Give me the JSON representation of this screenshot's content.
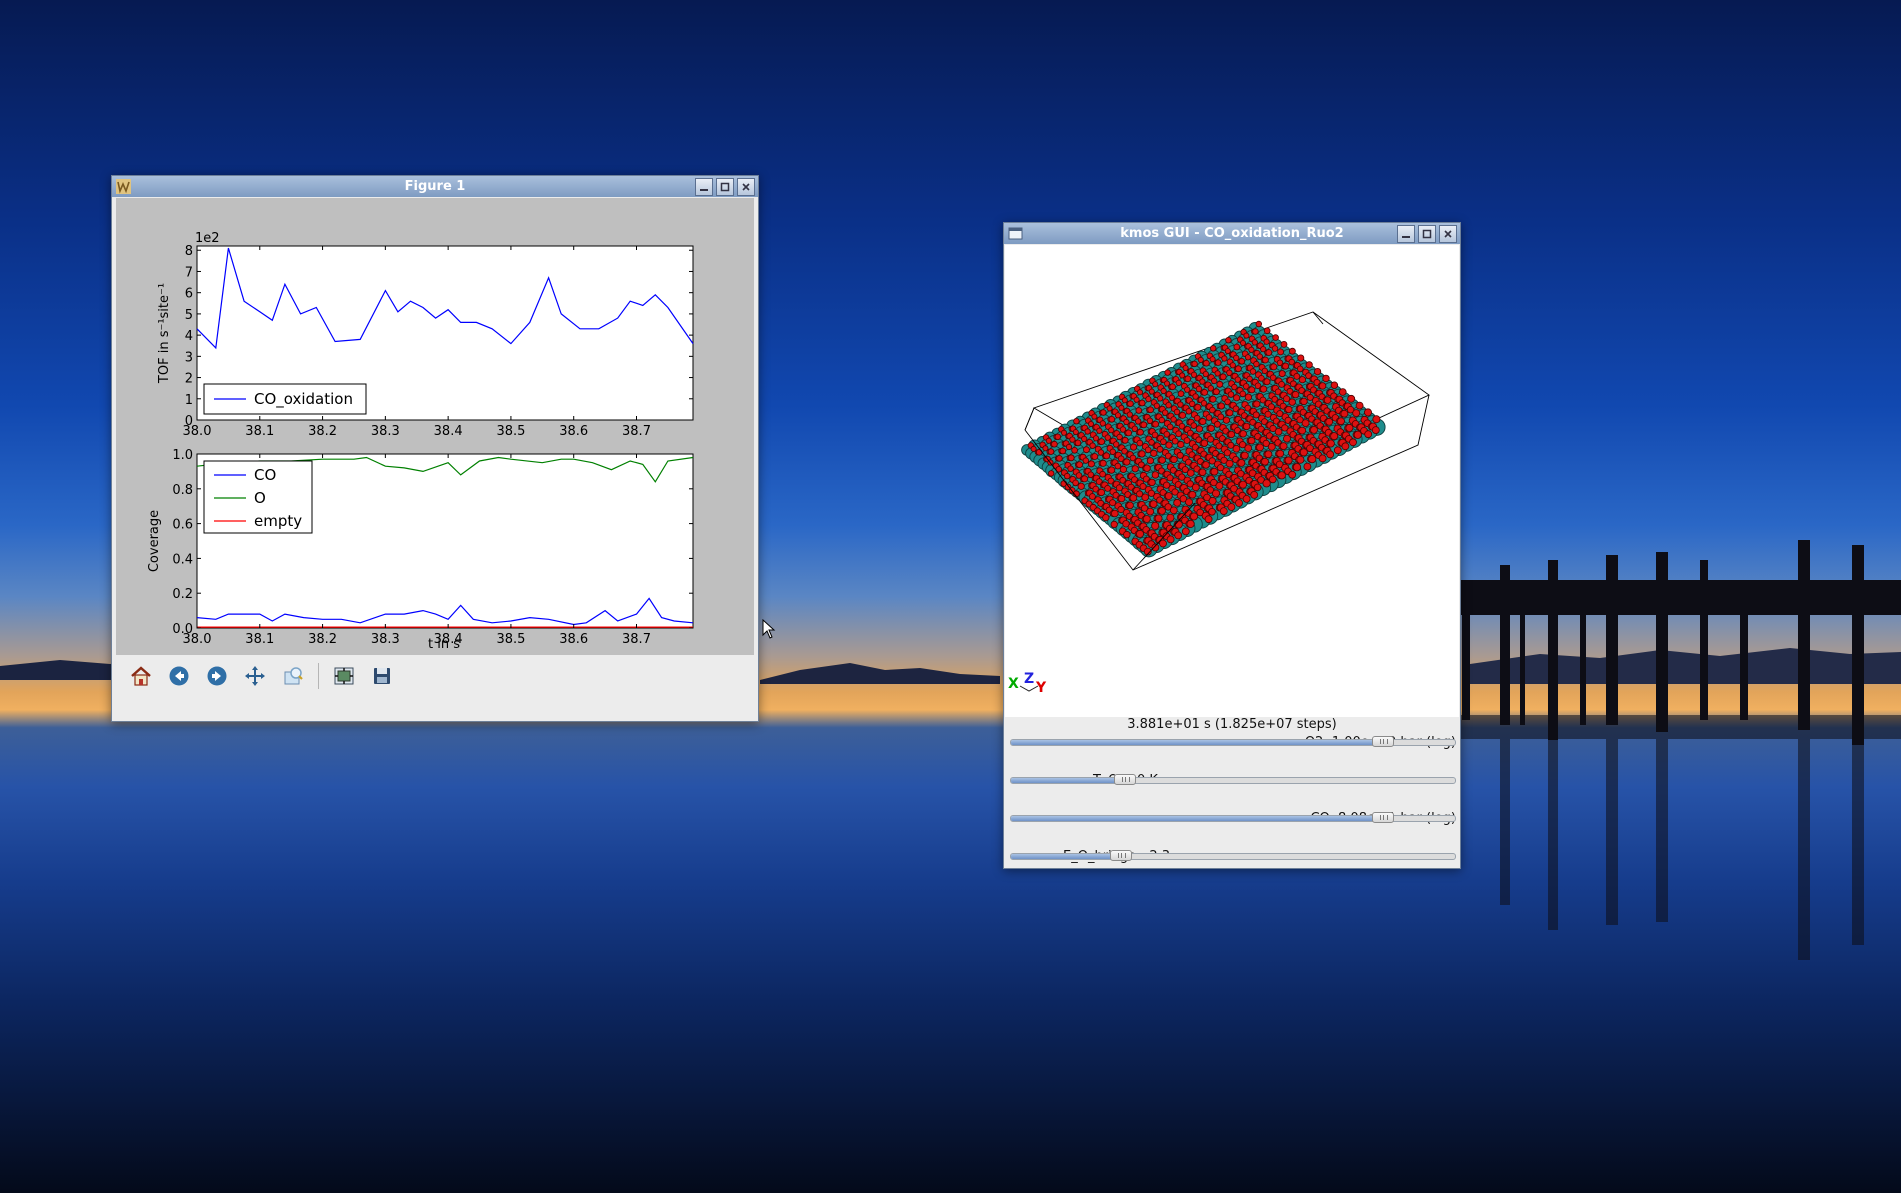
{
  "figure_window": {
    "title": "Figure 1",
    "toolbar": {
      "home": "home-icon",
      "back": "arrow-left-icon",
      "forward": "arrow-right-icon",
      "pan": "move-icon",
      "zoom": "zoom-icon",
      "configure": "subplots-icon",
      "save": "save-icon"
    }
  },
  "chart_data": [
    {
      "type": "line",
      "ylabel": "TOF in s⁻¹site⁻¹",
      "offset_text": "1e2",
      "xlim": [
        38.0,
        38.79
      ],
      "ylim": [
        0,
        8.2
      ],
      "xticks": [
        "38.0",
        "38.1",
        "38.2",
        "38.3",
        "38.4",
        "38.5",
        "38.6",
        "38.7"
      ],
      "yticks": [
        "0",
        "1",
        "2",
        "3",
        "4",
        "5",
        "6",
        "7",
        "8"
      ],
      "legend_position": "lower left",
      "series": [
        {
          "name": "CO_oxidation",
          "color": "#0000ff",
          "x": [
            38.0,
            38.03,
            38.05,
            38.075,
            38.1,
            38.12,
            38.14,
            38.165,
            38.19,
            38.22,
            38.26,
            38.3,
            38.32,
            38.34,
            38.36,
            38.38,
            38.4,
            38.42,
            38.445,
            38.47,
            38.5,
            38.53,
            38.56,
            38.58,
            38.61,
            38.64,
            38.67,
            38.69,
            38.71,
            38.73,
            38.75,
            38.79
          ],
          "values": [
            4.3,
            3.4,
            8.1,
            5.6,
            5.1,
            4.7,
            6.4,
            5.0,
            5.3,
            3.7,
            3.8,
            6.1,
            5.1,
            5.6,
            5.3,
            4.8,
            5.2,
            4.6,
            4.6,
            4.3,
            3.6,
            4.6,
            6.7,
            5.0,
            4.3,
            4.3,
            4.8,
            5.6,
            5.4,
            5.9,
            5.3,
            3.6
          ]
        }
      ]
    },
    {
      "type": "line",
      "xlabel": "t in s",
      "ylabel": "Coverage",
      "xlim": [
        38.0,
        38.79
      ],
      "ylim": [
        0.0,
        1.0
      ],
      "xticks": [
        "38.0",
        "38.1",
        "38.2",
        "38.3",
        "38.4",
        "38.5",
        "38.6",
        "38.7"
      ],
      "yticks": [
        "0.0",
        "0.2",
        "0.4",
        "0.6",
        "0.8",
        "1.0"
      ],
      "legend_position": "upper left",
      "series": [
        {
          "name": "CO",
          "color": "#0000ff",
          "x": [
            38.0,
            38.03,
            38.05,
            38.08,
            38.1,
            38.12,
            38.14,
            38.17,
            38.2,
            38.23,
            38.26,
            38.3,
            38.33,
            38.36,
            38.38,
            38.4,
            38.42,
            38.44,
            38.47,
            38.5,
            38.53,
            38.56,
            38.6,
            38.62,
            38.65,
            38.67,
            38.7,
            38.72,
            38.74,
            38.76,
            38.79
          ],
          "values": [
            0.06,
            0.05,
            0.08,
            0.08,
            0.08,
            0.04,
            0.08,
            0.06,
            0.05,
            0.05,
            0.03,
            0.08,
            0.08,
            0.1,
            0.08,
            0.05,
            0.13,
            0.05,
            0.03,
            0.04,
            0.06,
            0.05,
            0.02,
            0.03,
            0.1,
            0.04,
            0.08,
            0.17,
            0.06,
            0.04,
            0.03
          ]
        },
        {
          "name": "O",
          "color": "#008000",
          "x": [
            38.0,
            38.05,
            38.1,
            38.15,
            38.2,
            38.25,
            38.27,
            38.3,
            38.33,
            38.36,
            38.4,
            38.42,
            38.45,
            38.48,
            38.5,
            38.55,
            38.58,
            38.6,
            38.63,
            38.66,
            38.69,
            38.71,
            38.73,
            38.75,
            38.79
          ],
          "values": [
            0.93,
            0.95,
            0.96,
            0.96,
            0.97,
            0.97,
            0.98,
            0.93,
            0.92,
            0.9,
            0.95,
            0.88,
            0.96,
            0.98,
            0.97,
            0.95,
            0.97,
            0.97,
            0.95,
            0.91,
            0.96,
            0.94,
            0.84,
            0.96,
            0.98
          ]
        },
        {
          "name": "empty",
          "color": "#ff0000",
          "x": [
            38.0,
            38.79
          ],
          "values": [
            0.005,
            0.005
          ]
        }
      ]
    }
  ],
  "kmos_window": {
    "title": "kmos GUI - CO_oxidation_Ruo2",
    "axes_labels": {
      "x": "X",
      "y": "Y",
      "z": "Z"
    },
    "status": "3.881e+01 s (1.825e+07 steps)",
    "colors": {
      "large_atom": "#1f8c8c",
      "small_atom": "#dd1111"
    },
    "sliders": [
      {
        "label": "O2: 1.00e+00 bar (log)",
        "level": 0.84,
        "align": "right"
      },
      {
        "label": "T: 600.0 K",
        "level": 0.26,
        "align": "left"
      },
      {
        "label": "CO: 8.08e-01 bar (log)",
        "level": 0.84,
        "align": "right"
      },
      {
        "label": "E_O_bridge: -2.3",
        "level": 0.25,
        "align": "left"
      }
    ]
  }
}
